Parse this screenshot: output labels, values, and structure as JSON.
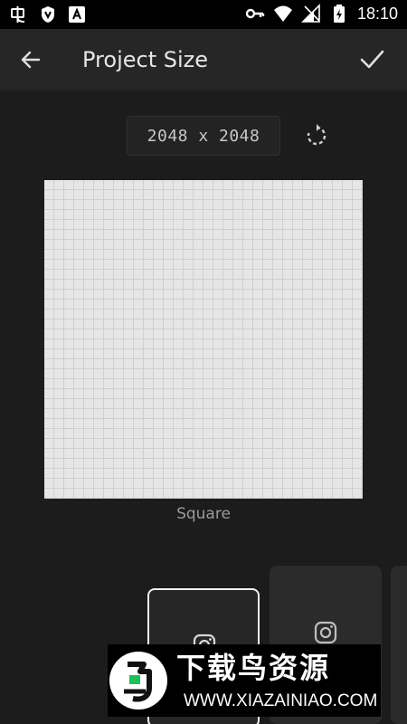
{
  "status_bar": {
    "time": "18:10",
    "left_icons": [
      "bug-icon",
      "shield-icon",
      "font-icon"
    ],
    "right_icons": [
      "key-icon",
      "wifi-icon",
      "signal-icon",
      "battery-icon"
    ]
  },
  "app_bar": {
    "title": "Project Size",
    "back_icon": "arrow-left-icon",
    "confirm_icon": "checkmark-icon"
  },
  "canvas": {
    "size_value": "2048 x 2048",
    "label": "Square",
    "rotate_icon": "rotate-icon"
  },
  "presets": {
    "cards": [
      {
        "icon": "instagram-icon",
        "selected": true
      },
      {
        "icon": "instagram-icon",
        "selected": false
      },
      {
        "icon": "",
        "selected": false
      }
    ]
  },
  "watermark": {
    "brand": "下载鸟资源",
    "url": "WWW.XIAZAINIAO.COM"
  },
  "colors": {
    "background": "#1c1c1c",
    "app_bar": "#262626",
    "status_bar": "#000000",
    "text_primary": "#e6e6e6",
    "text_secondary": "#9a9a9a",
    "canvas": "#e6e6e6",
    "grid_line": "#cfcfcf",
    "card": "#2b2b2b",
    "selected_border": "#f0f0f0",
    "watermark_green": "#19c25a"
  }
}
